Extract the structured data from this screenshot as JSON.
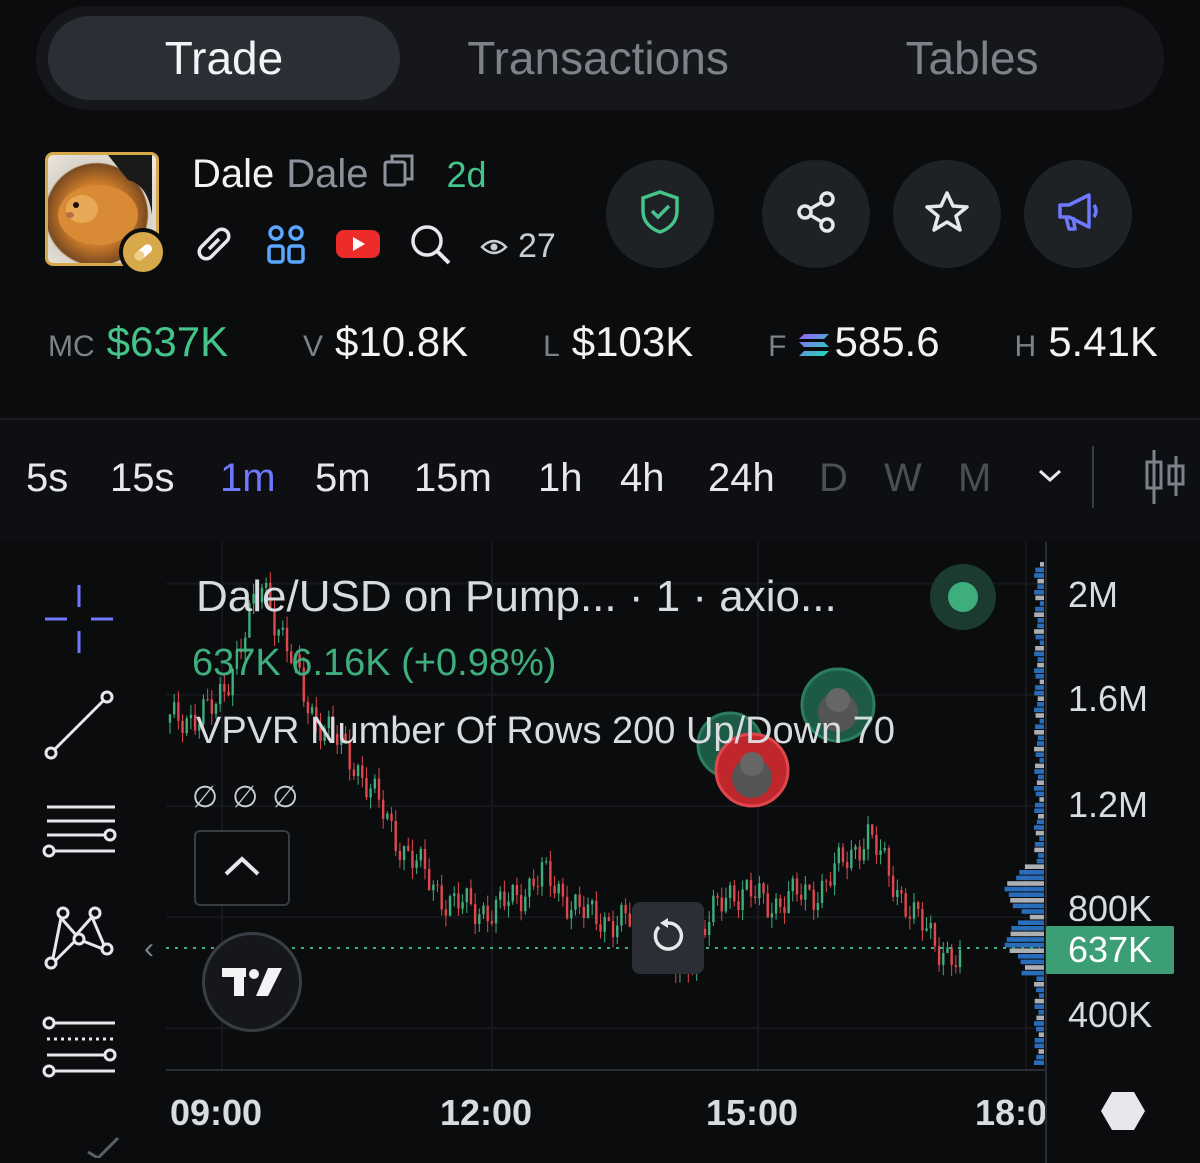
{
  "tabs": [
    {
      "label": "Trade",
      "active": true
    },
    {
      "label": "Transactions",
      "active": false
    },
    {
      "label": "Tables",
      "active": false
    }
  ],
  "token": {
    "symbol": "Dale",
    "name": "Dale",
    "age": "2d",
    "views": "27"
  },
  "header_icons": [
    "link-icon",
    "community-icon",
    "youtube-icon",
    "search-icon",
    "eye-icon"
  ],
  "actions": [
    "security-shield-icon",
    "share-icon",
    "star-icon",
    "megaphone-icon"
  ],
  "stats": [
    {
      "label": "MC",
      "value": "$637K",
      "color": "#45c48a"
    },
    {
      "label": "V",
      "value": "$10.8K"
    },
    {
      "label": "L",
      "value": "$103K"
    },
    {
      "label": "F",
      "value": "585.6",
      "icon": "solana-icon"
    },
    {
      "label": "H",
      "value": "5.41K"
    }
  ],
  "timeframes": [
    {
      "label": "5s"
    },
    {
      "label": "15s"
    },
    {
      "label": "1m",
      "active": true
    },
    {
      "label": "5m"
    },
    {
      "label": "15m"
    },
    {
      "label": "1h"
    },
    {
      "label": "4h"
    },
    {
      "label": "24h"
    },
    {
      "label": "D",
      "dim": true
    },
    {
      "label": "W",
      "dim": true
    },
    {
      "label": "M",
      "dim": true
    }
  ],
  "chart_legend": {
    "title": "Dale/USD on Pump... · 1 · axio...",
    "price_line": "637K 6.16K (+0.98%)",
    "vpvr": "VPVR Number Of Rows 200 Up/Down 70",
    "nulls": "∅∅∅"
  },
  "current_price_tag": "637K",
  "colors": {
    "up": "#3fae7d",
    "down": "#e0474c",
    "accent": "#6f79ff",
    "gain": "#45c48a"
  },
  "chart_data": {
    "type": "line",
    "title": "Dale/USD on Pump... · 1 · axio...",
    "x_ticks": [
      "09:00",
      "12:00",
      "15:00",
      "18:0"
    ],
    "y_ticks": [
      "2M",
      "1.6M",
      "1.2M",
      "800K",
      "400K"
    ],
    "ylim": [
      250000,
      2150000
    ],
    "series": [
      {
        "name": "Dale/USD",
        "x": [
          "09:00",
          "09:30",
          "10:00",
          "10:30",
          "11:00",
          "11:30",
          "12:00",
          "12:30",
          "13:00",
          "13:30",
          "14:00",
          "14:30",
          "15:00",
          "15:30",
          "16:00",
          "16:30",
          "17:00",
          "17:30"
        ],
        "values": [
          1500000,
          1550000,
          2000000,
          1550000,
          1350000,
          1050000,
          850000,
          820000,
          950000,
          800000,
          780000,
          600000,
          900000,
          850000,
          900000,
          1100000,
          800000,
          620000
        ]
      }
    ],
    "current_value": 637000
  }
}
